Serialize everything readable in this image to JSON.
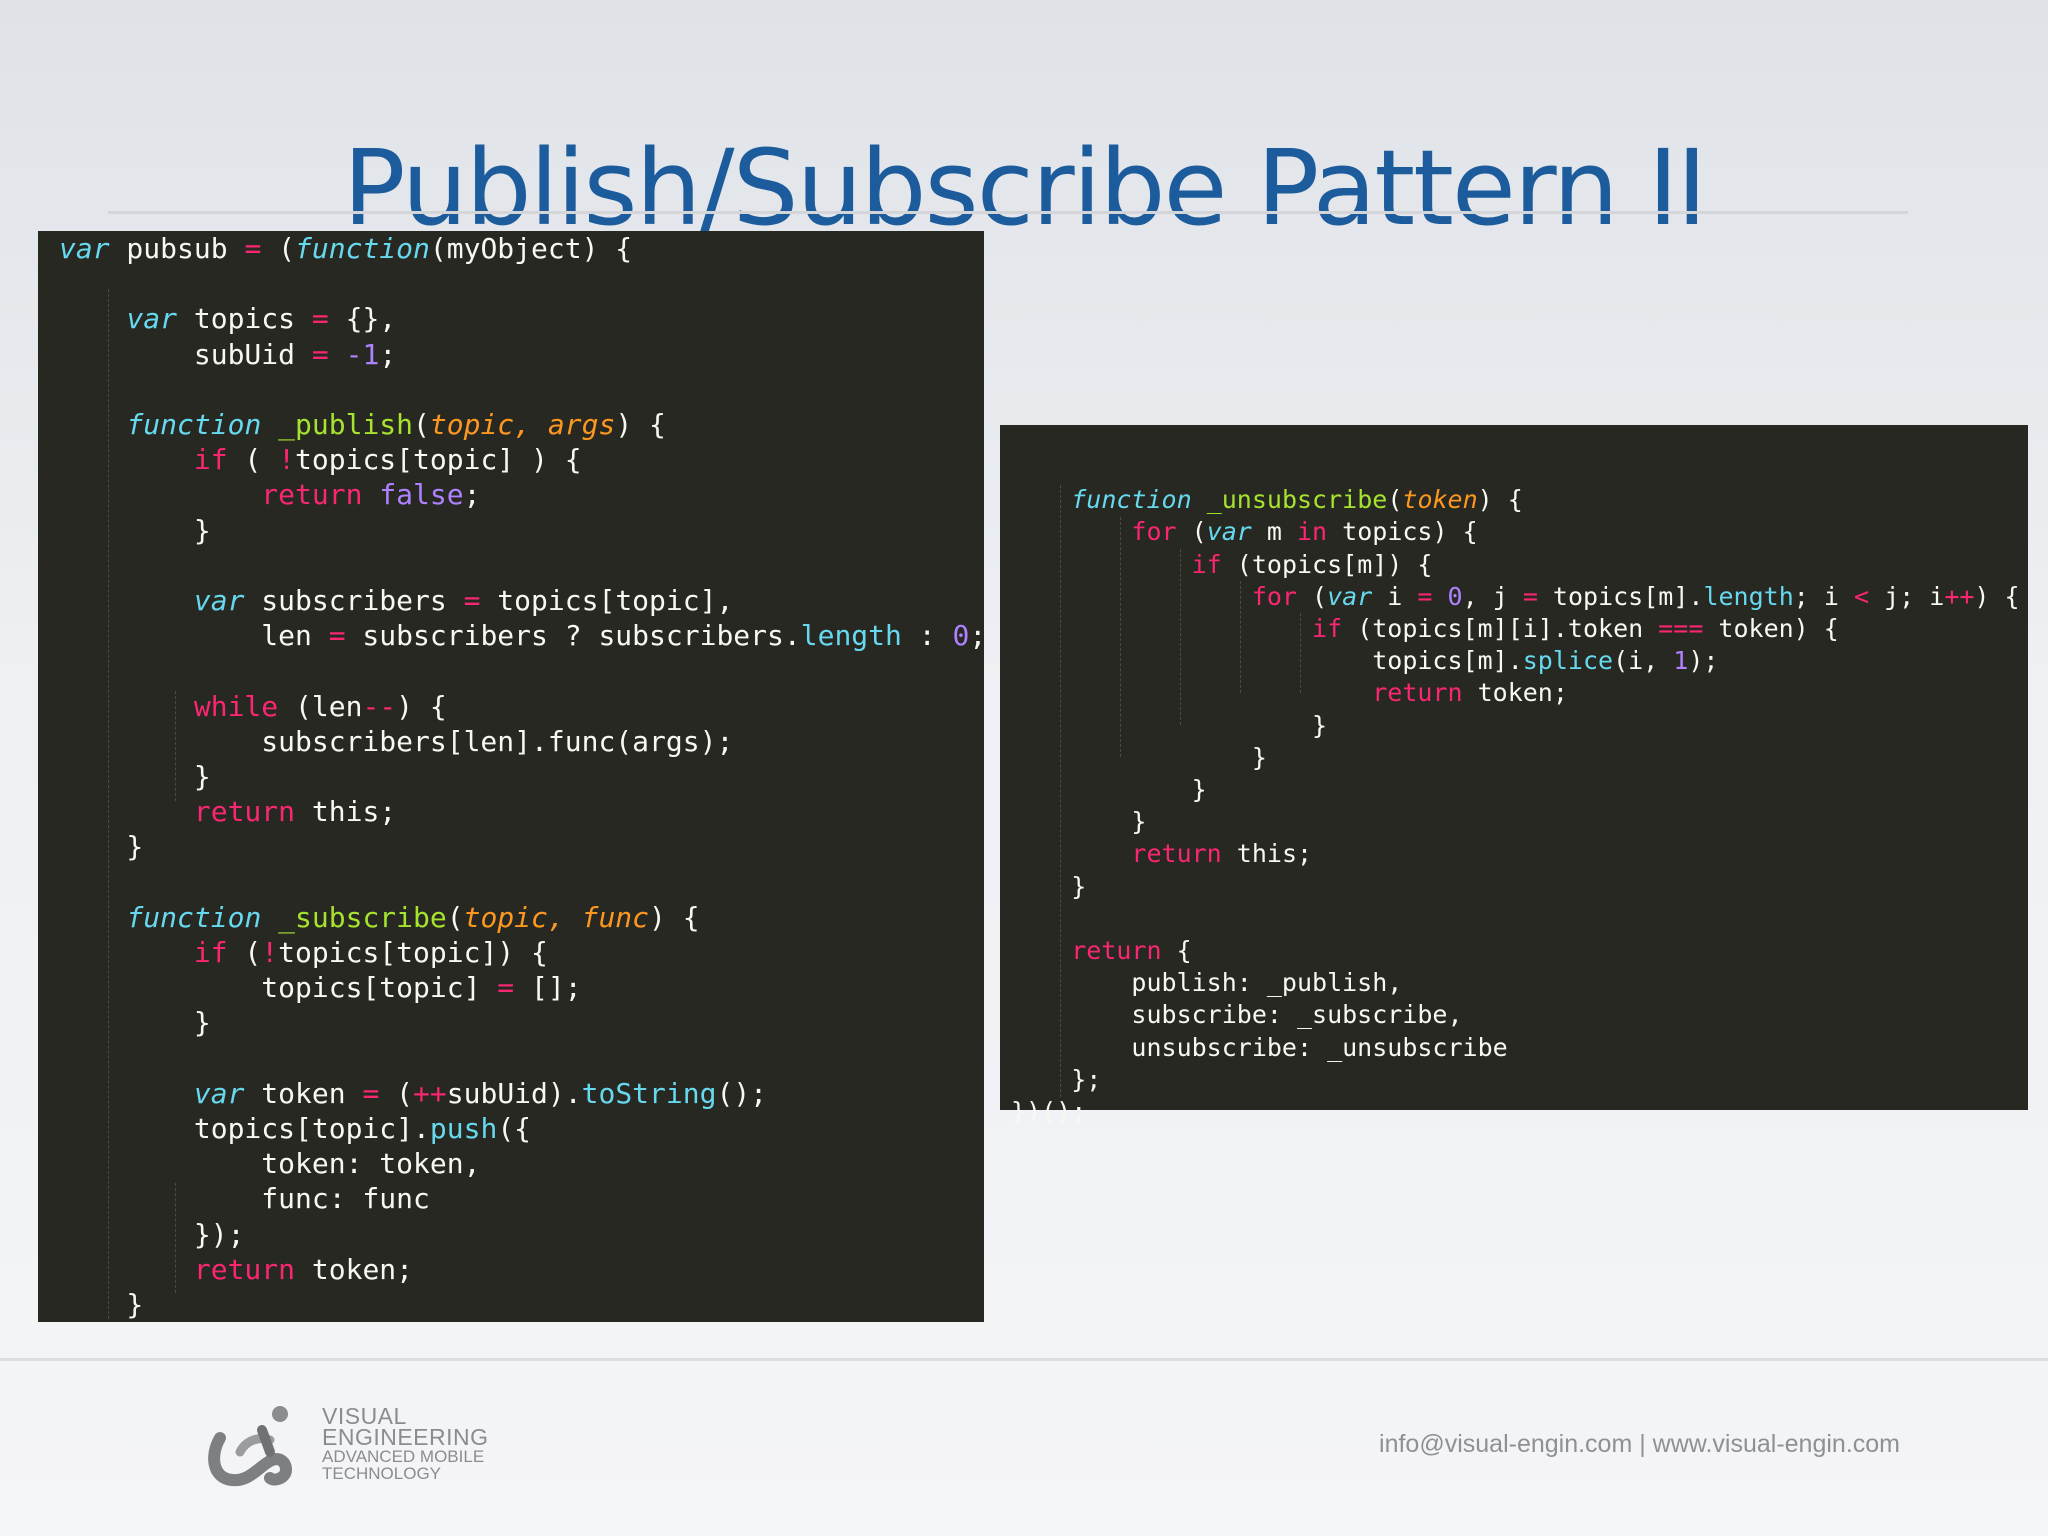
{
  "slide": {
    "title": "Publish/Subscribe Pattern II"
  },
  "code_left": {
    "lines": [
      [
        [
          "st",
          "var"
        ],
        [
          "tx",
          " pubsub "
        ],
        [
          "op",
          "="
        ],
        [
          "tx",
          " ("
        ],
        [
          "st",
          "function"
        ],
        [
          "tx",
          "(myObject) {"
        ]
      ],
      [],
      [
        [
          "tx",
          "    "
        ],
        [
          "st",
          "var"
        ],
        [
          "tx",
          " topics "
        ],
        [
          "op",
          "="
        ],
        [
          "tx",
          " {},"
        ]
      ],
      [
        [
          "tx",
          "        subUid "
        ],
        [
          "op",
          "="
        ],
        [
          "tx",
          " "
        ],
        [
          "nu",
          "-1"
        ],
        [
          "tx",
          ";"
        ]
      ],
      [],
      [
        [
          "tx",
          "    "
        ],
        [
          "st",
          "function"
        ],
        [
          "tx",
          " "
        ],
        [
          "fn",
          "_publish"
        ],
        [
          "tx",
          "("
        ],
        [
          "pa",
          "topic, args"
        ],
        [
          "tx",
          ") {"
        ]
      ],
      [
        [
          "tx",
          "        "
        ],
        [
          "kw",
          "if"
        ],
        [
          "tx",
          " ( "
        ],
        [
          "op",
          "!"
        ],
        [
          "tx",
          "topics[topic] ) {"
        ]
      ],
      [
        [
          "tx",
          "            "
        ],
        [
          "kw",
          "return"
        ],
        [
          "tx",
          " "
        ],
        [
          "nu",
          "false"
        ],
        [
          "tx",
          ";"
        ]
      ],
      [
        [
          "tx",
          "        }"
        ]
      ],
      [],
      [
        [
          "tx",
          "        "
        ],
        [
          "st",
          "var"
        ],
        [
          "tx",
          " subscribers "
        ],
        [
          "op",
          "="
        ],
        [
          "tx",
          " topics[topic],"
        ]
      ],
      [
        [
          "tx",
          "            len "
        ],
        [
          "op",
          "="
        ],
        [
          "tx",
          " subscribers ? subscribers."
        ],
        [
          "me",
          "length"
        ],
        [
          "tx",
          " : "
        ],
        [
          "nu",
          "0"
        ],
        [
          "tx",
          ";"
        ]
      ],
      [],
      [
        [
          "tx",
          "        "
        ],
        [
          "kw",
          "while"
        ],
        [
          "tx",
          " (len"
        ],
        [
          "op",
          "--"
        ],
        [
          "tx",
          ") {"
        ]
      ],
      [
        [
          "tx",
          "            subscribers[len].func(args);"
        ]
      ],
      [
        [
          "tx",
          "        }"
        ]
      ],
      [
        [
          "tx",
          "        "
        ],
        [
          "kw",
          "return"
        ],
        [
          "tx",
          " this;"
        ]
      ],
      [
        [
          "tx",
          "    }"
        ]
      ],
      [],
      [
        [
          "tx",
          "    "
        ],
        [
          "st",
          "function"
        ],
        [
          "tx",
          " "
        ],
        [
          "fn",
          "_subscribe"
        ],
        [
          "tx",
          "("
        ],
        [
          "pa",
          "topic, func"
        ],
        [
          "tx",
          ") {"
        ]
      ],
      [
        [
          "tx",
          "        "
        ],
        [
          "kw",
          "if"
        ],
        [
          "tx",
          " ("
        ],
        [
          "op",
          "!"
        ],
        [
          "tx",
          "topics[topic]) {"
        ]
      ],
      [
        [
          "tx",
          "            topics[topic] "
        ],
        [
          "op",
          "="
        ],
        [
          "tx",
          " [];"
        ]
      ],
      [
        [
          "tx",
          "        }"
        ]
      ],
      [],
      [
        [
          "tx",
          "        "
        ],
        [
          "st",
          "var"
        ],
        [
          "tx",
          " token "
        ],
        [
          "op",
          "="
        ],
        [
          "tx",
          " ("
        ],
        [
          "op",
          "++"
        ],
        [
          "tx",
          "subUid)."
        ],
        [
          "me",
          "toString"
        ],
        [
          "tx",
          "();"
        ]
      ],
      [
        [
          "tx",
          "        topics[topic]."
        ],
        [
          "me",
          "push"
        ],
        [
          "tx",
          "({"
        ]
      ],
      [
        [
          "tx",
          "            token: token,"
        ]
      ],
      [
        [
          "tx",
          "            func: func"
        ]
      ],
      [
        [
          "tx",
          "        });"
        ]
      ],
      [
        [
          "tx",
          "        "
        ],
        [
          "kw",
          "return"
        ],
        [
          "tx",
          " token;"
        ]
      ],
      [
        [
          "tx",
          "    }"
        ]
      ]
    ]
  },
  "code_right": {
    "lines": [
      [],
      [
        [
          "tx",
          "    "
        ],
        [
          "st",
          "function"
        ],
        [
          "tx",
          " "
        ],
        [
          "fn",
          "_unsubscribe"
        ],
        [
          "tx",
          "("
        ],
        [
          "pa",
          "token"
        ],
        [
          "tx",
          ") {"
        ]
      ],
      [
        [
          "tx",
          "        "
        ],
        [
          "kw",
          "for"
        ],
        [
          "tx",
          " ("
        ],
        [
          "st",
          "var"
        ],
        [
          "tx",
          " m "
        ],
        [
          "kw",
          "in"
        ],
        [
          "tx",
          " topics) {"
        ]
      ],
      [
        [
          "tx",
          "            "
        ],
        [
          "kw",
          "if"
        ],
        [
          "tx",
          " (topics[m]) {"
        ]
      ],
      [
        [
          "tx",
          "                "
        ],
        [
          "kw",
          "for"
        ],
        [
          "tx",
          " ("
        ],
        [
          "st",
          "var"
        ],
        [
          "tx",
          " i "
        ],
        [
          "op",
          "="
        ],
        [
          "tx",
          " "
        ],
        [
          "nu",
          "0"
        ],
        [
          "tx",
          ", j "
        ],
        [
          "op",
          "="
        ],
        [
          "tx",
          " topics[m]."
        ],
        [
          "me",
          "length"
        ],
        [
          "tx",
          "; i "
        ],
        [
          "op",
          "<"
        ],
        [
          "tx",
          " j; i"
        ],
        [
          "op",
          "++"
        ],
        [
          "tx",
          ") {"
        ]
      ],
      [
        [
          "tx",
          "                    "
        ],
        [
          "kw",
          "if"
        ],
        [
          "tx",
          " (topics[m][i].token "
        ],
        [
          "op",
          "==="
        ],
        [
          "tx",
          " token) {"
        ]
      ],
      [
        [
          "tx",
          "                        topics[m]."
        ],
        [
          "me",
          "splice"
        ],
        [
          "tx",
          "(i, "
        ],
        [
          "nu",
          "1"
        ],
        [
          "tx",
          ");"
        ]
      ],
      [
        [
          "tx",
          "                        "
        ],
        [
          "kw",
          "return"
        ],
        [
          "tx",
          " token;"
        ]
      ],
      [
        [
          "tx",
          "                    }"
        ]
      ],
      [
        [
          "tx",
          "                }"
        ]
      ],
      [
        [
          "tx",
          "            }"
        ]
      ],
      [
        [
          "tx",
          "        }"
        ]
      ],
      [
        [
          "tx",
          "        "
        ],
        [
          "kw",
          "return"
        ],
        [
          "tx",
          " this;"
        ]
      ],
      [
        [
          "tx",
          "    }"
        ]
      ],
      [],
      [
        [
          "tx",
          "    "
        ],
        [
          "kw",
          "return"
        ],
        [
          "tx",
          " {"
        ]
      ],
      [
        [
          "tx",
          "        publish: _publish,"
        ]
      ],
      [
        [
          "tx",
          "        subscribe: _subscribe,"
        ]
      ],
      [
        [
          "tx",
          "        unsubscribe: _unsubscribe"
        ]
      ],
      [
        [
          "tx",
          "    };"
        ]
      ],
      [
        [
          "tx",
          "})();"
        ]
      ]
    ]
  },
  "footer": {
    "logo_line1": "VISUAL",
    "logo_line2": "ENGINEERING",
    "logo_line3": "ADVANCED MOBILE",
    "logo_line4": "TECHNOLOGY",
    "contact": "info@visual-engin.com | www.visual-engin.com"
  }
}
